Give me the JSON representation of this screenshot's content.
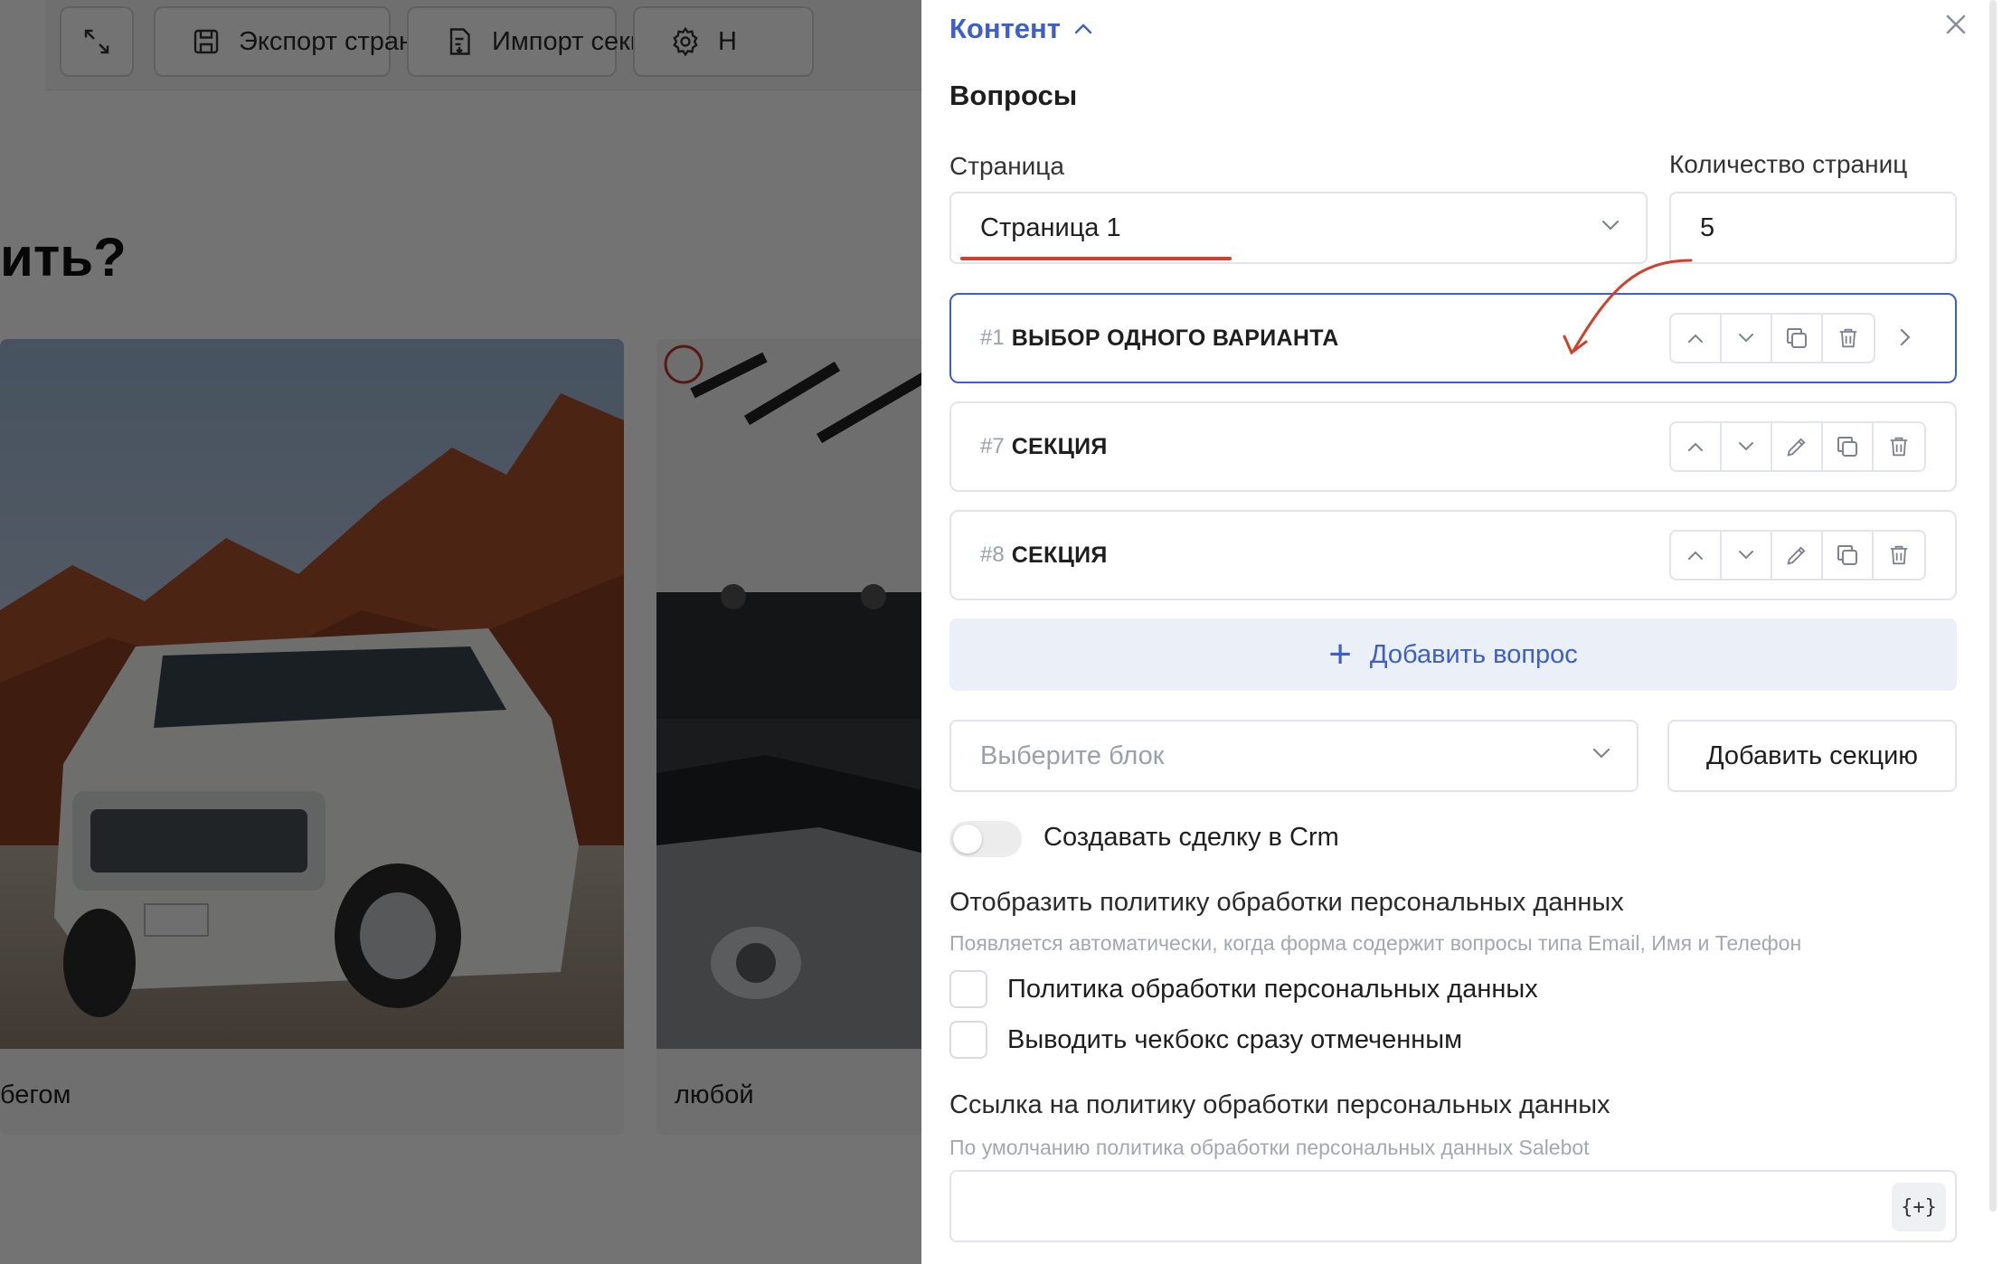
{
  "background": {
    "toolbar": {
      "buttons": [
        {
          "label": "",
          "icon": "expand-icon"
        },
        {
          "label": "Экспорт страницы",
          "icon": "save-icon"
        },
        {
          "label": "Импорт секции",
          "icon": "import-icon"
        },
        {
          "label": "Н",
          "icon": "gear-icon"
        }
      ]
    },
    "heading": "ить?",
    "cards": [
      {
        "label": "бегом"
      },
      {
        "label": "любой"
      }
    ]
  },
  "panel": {
    "header": {
      "title": "Контент"
    },
    "section_title": "Вопросы",
    "page_select": {
      "label": "Страница",
      "value": "Страница 1"
    },
    "page_count": {
      "label": "Количество страниц",
      "value": "5"
    },
    "questions": [
      {
        "number": "#1",
        "title": "ВЫБОР ОДНОГО ВАРИАНТА",
        "active": true
      },
      {
        "number": "#7",
        "title": "СЕКЦИЯ",
        "active": false
      },
      {
        "number": "#8",
        "title": "СЕКЦИЯ",
        "active": false
      }
    ],
    "add_question_label": "Добавить вопрос",
    "block_select": {
      "placeholder": "Выберите блок"
    },
    "add_section_label": "Добавить секцию",
    "crm_toggle": {
      "label": "Создавать сделку в Crm",
      "on": false
    },
    "privacy": {
      "title": "Отобразить политику обработки персональных данных",
      "hint": "Появляется автоматически, когда форма содержит вопросы типа Email, Имя и Телефон",
      "checkboxes": [
        {
          "label": "Политика обработки персональных данных",
          "checked": false
        },
        {
          "label": "Выводить чекбокс сразу отмеченным",
          "checked": false
        }
      ]
    },
    "privacy_link": {
      "label": "Ссылка на политику обработки персональных данных",
      "hint": "По умолчанию политика обработки персональных данных Salebot",
      "value": "",
      "var_button": "{+}"
    }
  },
  "colors": {
    "accent": "#3e5ec9",
    "accent_light": "#eaeff8",
    "border": "#e1e4ea",
    "annotation": "#d0402a"
  }
}
